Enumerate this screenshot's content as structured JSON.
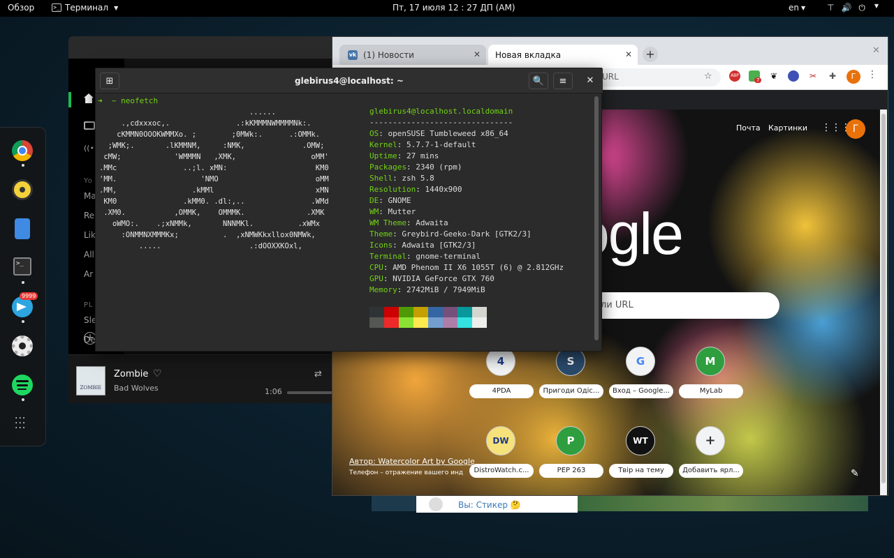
{
  "topbar": {
    "overview": "Обзор",
    "app_menu": "Терминал",
    "clock": "Пт, 17 июля  12 : 27 ДП (AM)",
    "lang": "en",
    "network": "⊤",
    "volume": "🔊",
    "power": "⏻"
  },
  "dock": {
    "apps": [
      "chrome",
      "rhythmbox",
      "files",
      "terminal",
      "telegram",
      "settings",
      "spotify",
      "app-grid"
    ],
    "telegram_badge": "9999"
  },
  "spotify": {
    "sidebar": {
      "items": [
        "Yo",
        "Ma",
        "Re",
        "Lik",
        "All",
        "Ar"
      ],
      "section_playlists": "PL",
      "playlist_items": [
        "Sle",
        "De"
      ]
    },
    "track": "Zombie",
    "artist": "Bad Wolves",
    "time": "1:06",
    "cover_text": "ZOMBIE"
  },
  "chrome": {
    "tabs": [
      {
        "label": "(1) Новости",
        "favicon": "vk-icon"
      },
      {
        "label": "Новая вкладка",
        "favicon": ""
      }
    ],
    "new_tab": "+",
    "window_close": "✕",
    "omnibox_fragment": "URL",
    "avatar_letter": "Г",
    "extensions": [
      "ABP",
      "7"
    ],
    "page": {
      "mail": "Почта",
      "images": "Картинки",
      "logo": "ogle",
      "search_placeholder": "ли URL",
      "shortcuts_row1": [
        {
          "label": "4PDA",
          "glyph": "4"
        },
        {
          "label": "Пригоди Одіс...",
          "glyph": "S"
        },
        {
          "label": "Вход – Google...",
          "glyph": "G"
        },
        {
          "label": "MyLab",
          "glyph": "M"
        }
      ],
      "shortcuts_row2": [
        {
          "label": "DistroWatch.c...",
          "glyph": "DW"
        },
        {
          "label": "PEP 263",
          "glyph": "P"
        },
        {
          "label": "Твір на тему",
          "glyph": "WT"
        },
        {
          "label": "Добавить ярл...",
          "glyph": "+"
        }
      ],
      "author": "Автор: Watercolor Art by Google",
      "caption": "Телефон – отражение вашего инд"
    }
  },
  "telegram_strip": {
    "text": "Вы: Стикер 🤔"
  },
  "terminal": {
    "title": "glebirus4@localhost: ~",
    "prompt": "➜  ~ neofetch",
    "art_lines": [
      "                                  ......",
      "     .,cdxxxoc,.               .:kKMMMNWMMMMNk:.",
      "    cKMMN0OOOKWMMXo. ;        ;0MWk:.      .:OMMk.",
      "  ;WMK;.       .lKMMNM,     :NMK,             .OMW;",
      " cMW;            'WMMMN   ,XMK,                 oMM'",
      ".MMc               ..;l. xMN:                    KM0",
      "'MM.                   'NMO                      oMM",
      ".MM,                 .kMMl                       xMN",
      " KM0               .kMM0. .dl:,..               .WMd",
      " .XM0.           ,OMMK,    OMMMK.              .XMK",
      "   oWMO:.    .;xNMMk,       NNNMKl.          .xWMx",
      "     :ONMMNXMMMKx;          .  ,xNMWKkxllox0NMWk,",
      "         .....                    .:dOOXXKOxl,"
    ],
    "userhost": "glebirus4@localhost.localdomain",
    "separator": "-------------------------------",
    "info": [
      {
        "key": "OS",
        "value": "openSUSE Tumbleweed x86_64"
      },
      {
        "key": "Kernel",
        "value": "5.7.7-1-default"
      },
      {
        "key": "Uptime",
        "value": "27 mins"
      },
      {
        "key": "Packages",
        "value": "2340 (rpm)"
      },
      {
        "key": "Shell",
        "value": "zsh 5.8"
      },
      {
        "key": "Resolution",
        "value": "1440x900"
      },
      {
        "key": "DE",
        "value": "GNOME"
      },
      {
        "key": "WM",
        "value": "Mutter"
      },
      {
        "key": "WM Theme",
        "value": "Adwaita"
      },
      {
        "key": "Theme",
        "value": "Greybird-Geeko-Dark [GTK2/3]"
      },
      {
        "key": "Icons",
        "value": "Adwaita [GTK2/3]"
      },
      {
        "key": "Terminal",
        "value": "gnome-terminal"
      },
      {
        "key": "CPU",
        "value": "AMD Phenom II X6 1055T (6) @ 2.812GHz"
      },
      {
        "key": "GPU",
        "value": "NVIDIA GeForce GTX 760"
      },
      {
        "key": "Memory",
        "value": "2742MiB / 7949MiB"
      }
    ],
    "palette_top": [
      "#2e3436",
      "#cc0000",
      "#4e9a06",
      "#c4a000",
      "#3465a4",
      "#75507b",
      "#06989a",
      "#d3d7cf"
    ],
    "palette_bottom": [
      "#555753",
      "#ef2929",
      "#8ae234",
      "#fce94f",
      "#729fcf",
      "#ad7fa8",
      "#34e2e2",
      "#eeeeec"
    ]
  }
}
